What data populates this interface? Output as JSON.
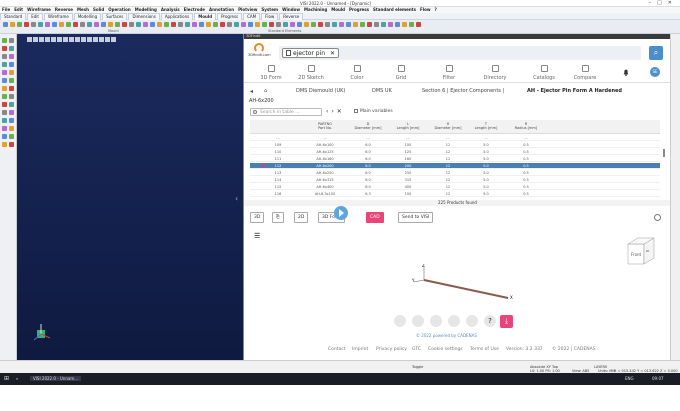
{
  "window": {
    "title": "VISI 2022.0 - Unnamed - [Dynamic]"
  },
  "menu": [
    "File",
    "Edit",
    "Wireframe",
    "Reverse",
    "Mesh",
    "Solid",
    "Operation",
    "Modelling",
    "Analysis",
    "Electrode",
    "Annotation",
    "Plotview",
    "System",
    "Window",
    "Machining",
    "Mould",
    "Progress",
    "Standard elements",
    "Flow",
    "?"
  ],
  "tabs": [
    "Standard",
    "Edit",
    "Wireframe",
    "Modelling",
    "Surfaces",
    "Dimensions",
    "Applications",
    "Mould",
    "Progress",
    "CAM",
    "Flow",
    "Reverse"
  ],
  "ribbon_labels": {
    "mould": "Mould",
    "standard_elements": "Standard Elements"
  },
  "panel": {
    "title": "3DFindIt",
    "logo_text": "3Dfindit.com",
    "search_chip": "ejector pin",
    "nav": [
      "3D Form",
      "2D Sketch",
      "Color",
      "Grid",
      "Filter",
      "Directory",
      "Catalogs",
      "Compare"
    ],
    "avatar": "SE",
    "breadcrumbs": [
      "DMS Diemould (UK)",
      "DMS UK",
      "Section 6 | Ejector Components |",
      "AH - Ejector Pin Form A Hardened"
    ],
    "part_code": "AH-6x200",
    "table_search_placeholder": "Search in table ...",
    "main_variables": "Main variables",
    "columns": [
      {
        "h": "PARTNO",
        "s": "Part No."
      },
      {
        "h": "D",
        "s": "Diameter [mm]"
      },
      {
        "h": "L",
        "s": "Length [mm]"
      },
      {
        "h": "H",
        "s": "Diameter [mm]"
      },
      {
        "h": "T",
        "s": "Length [mm]"
      },
      {
        "h": "R",
        "s": "Radius [mm]"
      }
    ],
    "rows": [
      {
        "n": "...",
        "p": "...",
        "d": "...",
        "l": "...",
        "h": "...",
        "t": "...",
        "r": "..."
      },
      {
        "n": "109",
        "p": "AH-6x100",
        "d": "6.0",
        "l": "100",
        "h": "12",
        "t": "5.0",
        "r": "0.5"
      },
      {
        "n": "110",
        "p": "AH-6x125",
        "d": "6.0",
        "l": "125",
        "h": "12",
        "t": "5.0",
        "r": "0.5"
      },
      {
        "n": "111",
        "p": "AH-6x160",
        "d": "6.0",
        "l": "160",
        "h": "12",
        "t": "5.0",
        "r": "0.5"
      },
      {
        "n": "112",
        "p": "AH-6x200",
        "d": "6.0",
        "l": "200",
        "h": "12",
        "t": "5.0",
        "r": "0.5",
        "selected": true
      },
      {
        "n": "113",
        "p": "AH-6x250",
        "d": "6.0",
        "l": "250",
        "h": "12",
        "t": "5.0",
        "r": "0.5"
      },
      {
        "n": "114",
        "p": "AH-6x315",
        "d": "6.0",
        "l": "315",
        "h": "12",
        "t": "5.0",
        "r": "0.5"
      },
      {
        "n": "115",
        "p": "AH-6x400",
        "d": "6.0",
        "l": "400",
        "h": "12",
        "t": "5.0",
        "r": "0.5"
      },
      {
        "n": "116",
        "p": "AH-6.3x100",
        "d": "6.3",
        "l": "100",
        "h": "12",
        "t": "5.0",
        "r": "0.5"
      }
    ],
    "products_found": "225 Products found",
    "preview_buttons": {
      "btn_3d": "3D",
      "btn_2d": "2D",
      "btn_form": "3D Form",
      "btn_cad": "CAD",
      "btn_send": "Send to VISI"
    },
    "cube": {
      "front": "Front",
      "right": "Rt"
    },
    "axes": {
      "x": "X",
      "y": "Y",
      "z": "Z"
    },
    "powered": "© 2022 powered by CADENAS",
    "footer": [
      "Contact",
      "Imprint",
      "Privacy policy",
      "GTC",
      "Cookie settings",
      "Terms of Use",
      "Version: 3.2.337",
      "© 2022 | CADENAS"
    ]
  },
  "status": {
    "toggle": "Toggle",
    "abs": "Absolute XY Top",
    "layer": "LAYER0",
    "units": "Units: MM",
    "coords": "X = 015.442 Y = 013.622 Z = 0.000",
    "scale": "LS: 1.00 PS: 1.00",
    "view": "View: ABS"
  },
  "taskbar": {
    "app": "VISI 2022.0 - Unnam...",
    "lang": "ENG",
    "time": "09:07"
  },
  "colors": {
    "accent": "#4a8fcb",
    "cad": "#e9457a",
    "selection": "#4a7fb4"
  }
}
